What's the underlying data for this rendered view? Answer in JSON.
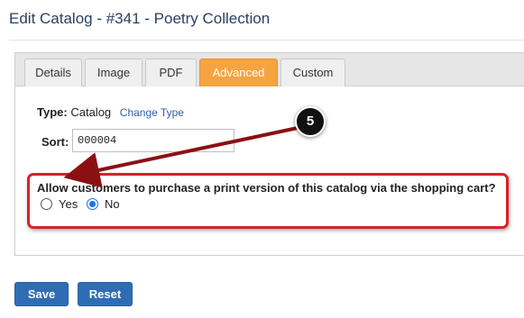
{
  "page": {
    "title": "Edit Catalog - #341 - Poetry Collection"
  },
  "tabs": [
    {
      "label": "Details",
      "active": false
    },
    {
      "label": "Image",
      "active": false
    },
    {
      "label": "PDF",
      "active": false
    },
    {
      "label": "Advanced",
      "active": true
    },
    {
      "label": "Custom",
      "active": false
    }
  ],
  "type_field": {
    "label": "Type:",
    "value": "Catalog",
    "change_link": "Change Type"
  },
  "sort_field": {
    "label": "Sort:",
    "value": "000004"
  },
  "print_option": {
    "question": "Allow customers to purchase a print version of this catalog via the shopping cart?",
    "options": [
      {
        "label": "Yes",
        "checked": false
      },
      {
        "label": "No",
        "checked": true
      }
    ]
  },
  "annotation": {
    "step_number": "5"
  },
  "buttons": {
    "save": "Save",
    "reset": "Reset"
  },
  "colors": {
    "accent_tab": "#f6a440",
    "primary_button": "#2e6db4",
    "annotation_red": "#d7222a",
    "link": "#2f5fa8"
  }
}
